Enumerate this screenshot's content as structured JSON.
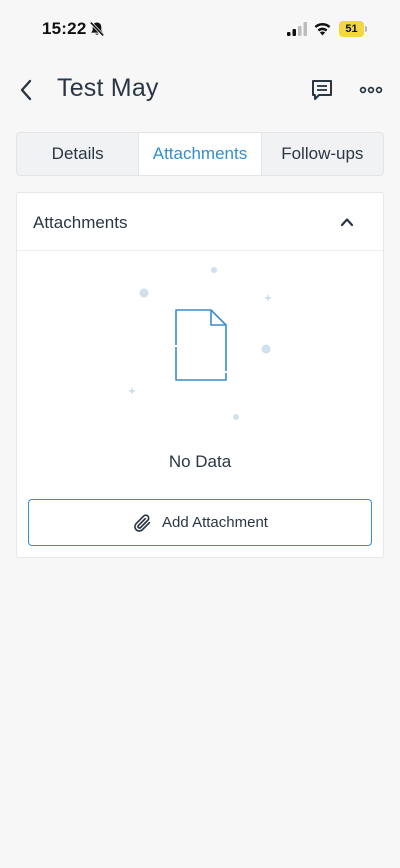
{
  "status_bar": {
    "time": "15:22",
    "battery": "51"
  },
  "header": {
    "title": "Test May"
  },
  "tabs": [
    {
      "label": "Details",
      "active": false
    },
    {
      "label": "Attachments",
      "active": true
    },
    {
      "label": "Follow-ups",
      "active": false
    }
  ],
  "attachments": {
    "section_title": "Attachments",
    "empty_text": "No Data",
    "add_button_label": "Add Attachment"
  },
  "colors": {
    "accent": "#2f8fd3",
    "button_border": "#3a8ec9",
    "battery": "#f3d646",
    "text": "#2a3644"
  },
  "icons": {
    "back": "chevron-left-icon",
    "comment": "comment-icon",
    "more": "ellipsis-icon",
    "collapse": "chevron-up-icon",
    "empty": "document-icon",
    "add": "paperclip-icon"
  }
}
